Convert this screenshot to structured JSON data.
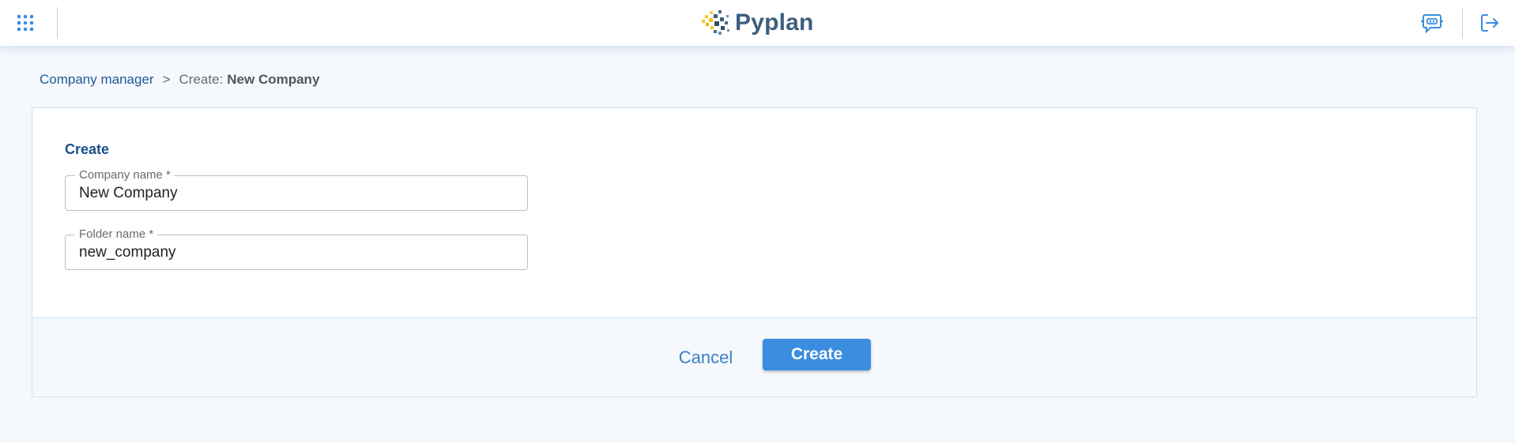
{
  "app": {
    "name": "Pyplan"
  },
  "header": {
    "apps_icon": "grid-apps-icon",
    "logo_text": "Pyplan",
    "chat_icon": "chat-bot-icon",
    "logout_icon": "logout-icon"
  },
  "breadcrumb": {
    "parent": "Company manager",
    "separator": ">",
    "current_prefix": "Create:",
    "current": "New Company"
  },
  "form": {
    "title": "Create",
    "fields": [
      {
        "label": "Company name *",
        "value": "New Company"
      },
      {
        "label": "Folder name *",
        "value": "new_company"
      }
    ]
  },
  "actions": {
    "cancel_label": "Cancel",
    "create_label": "Create"
  },
  "colors": {
    "accent": "#3a8ddf",
    "title": "#1b4f8a",
    "logo_text": "#3e5f7e",
    "background": "#f5f8fc"
  }
}
